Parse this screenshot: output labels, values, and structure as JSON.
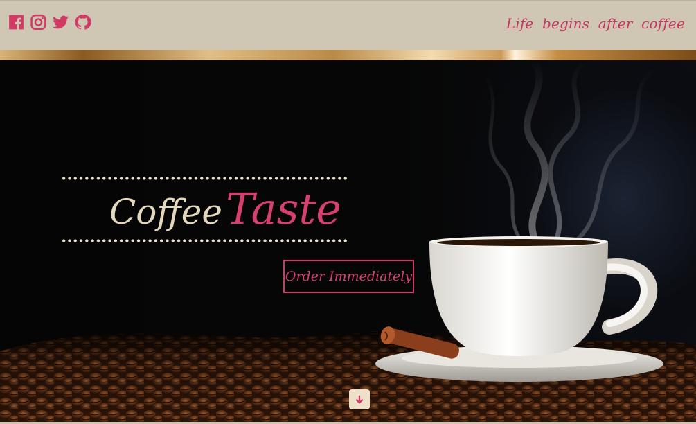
{
  "header": {
    "social_icons": [
      "facebook-icon",
      "instagram-icon",
      "twitter-icon",
      "github-icon"
    ],
    "tagline": "Life begins after coffee"
  },
  "hero": {
    "title_part1": "Coffee",
    "title_part2": "Taste",
    "cta_label": "Order Immediately",
    "scroll_icon": "arrow-down-icon"
  },
  "colors": {
    "accent": "#d23a66",
    "header_bg": "#cfc7b4",
    "title_cream": "#e3d8bd",
    "scroll_button_bg": "#eedfc9"
  }
}
